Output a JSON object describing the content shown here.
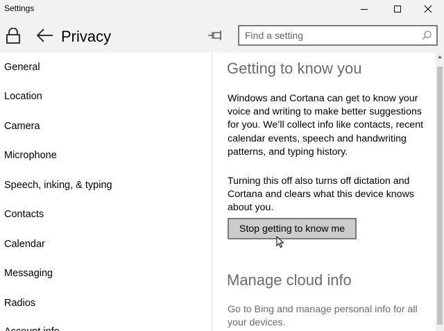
{
  "window": {
    "title": "Settings"
  },
  "header": {
    "title": "Privacy",
    "search_placeholder": "Find a setting"
  },
  "sidebar": {
    "items": [
      {
        "label": "General"
      },
      {
        "label": "Location"
      },
      {
        "label": "Camera"
      },
      {
        "label": "Microphone"
      },
      {
        "label": "Speech, inking, & typing"
      },
      {
        "label": "Contacts"
      },
      {
        "label": "Calendar"
      },
      {
        "label": "Messaging"
      },
      {
        "label": "Radios"
      },
      {
        "label": "Account info"
      }
    ]
  },
  "content": {
    "section1_title": "Getting to know you",
    "para1": "Windows and Cortana can get to know your voice and writing to make better suggestions for you. We’ll collect info like contacts, recent calendar events, speech and handwriting patterns, and typing history.",
    "para2": "Turning this off also turns off dictation and Cortana and clears what this device knows about you.",
    "button_label": "Stop getting to know me",
    "section2_title": "Manage cloud info",
    "para3": "Go to Bing and manage personal info for all your devices."
  },
  "colors": {
    "chrome": "#f2f2f2",
    "panel": "#ffffff",
    "muted_text": "#6b6b6b",
    "button_bg": "#cccccc",
    "button_border": "#7a7a7a"
  }
}
